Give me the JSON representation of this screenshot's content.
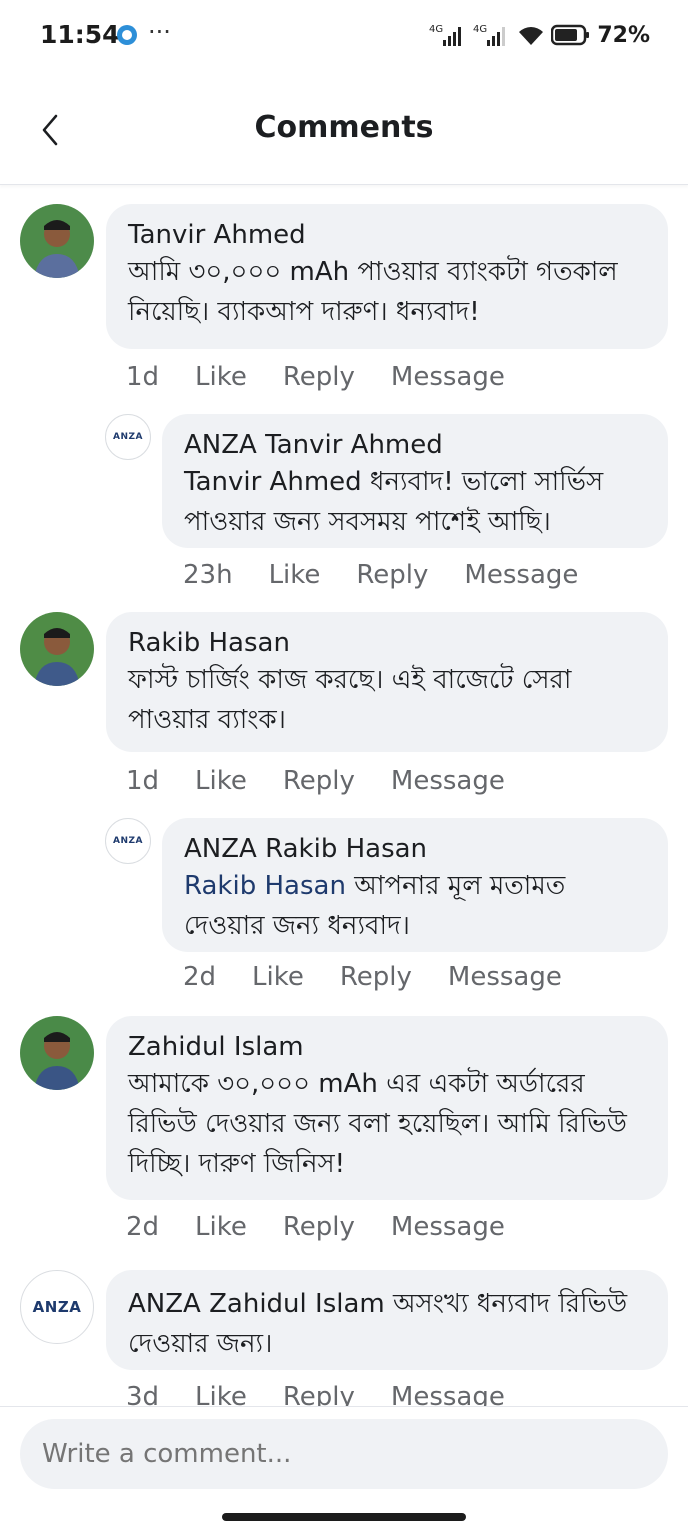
{
  "status_bar": {
    "time": "11:54",
    "dots": "···",
    "battery": "72%",
    "network1": "4G",
    "network2": "4G"
  },
  "header": {
    "title": "Comments",
    "back_icon": "chevron-left-icon"
  },
  "comments": [
    {
      "author": "Tanvir Ahmed",
      "text": "আমি ৩০,০০০ mAh পাওয়ার ব্যাংকটা গতকাল নিয়েছি। ব্যাকআপ দারুণ। ধন্যবাদ!",
      "time": "1d",
      "like": "Like",
      "reply": "Reply",
      "message": "Message"
    },
    {
      "author": "ANZA",
      "mention": "Tanvir Ahmed",
      "text": "Tanvir Ahmed ধন্যবাদ! ভালো সার্ভিস পাওয়ার জন্য সবসময় পাশেই আছি।",
      "time": "23h",
      "like": "Like",
      "reply": "Reply",
      "message": "Message"
    },
    {
      "author": "Rakib Hasan",
      "text": "ফাস্ট চার্জিং কাজ করছে। এই বাজেটে সেরা পাওয়ার ব্যাংক।",
      "time": "1d",
      "like": "Like",
      "reply": "Reply",
      "message": "Message"
    },
    {
      "author": "ANZA",
      "mention": "Rakib Hasan",
      "text": "আপনার মূল মতামত দেওয়ার জন্য ধন্যবাদ।",
      "time": "2d",
      "like": "Like",
      "reply": "Reply",
      "message": "Message"
    },
    {
      "author": "Zahidul Islam",
      "text": "আমাকে ৩০,০০০ mAh এর একটা অর্ডারের রিভিউ দেওয়ার জন্য বলা হয়েছিল। আমি রিভিউ দিচ্ছি। দারুণ জিনিস!",
      "time": "2d",
      "like": "Like",
      "reply": "Reply",
      "message": "Message"
    },
    {
      "author": "ANZA",
      "mention": "Zahidul Islam",
      "text": "অসংখ্য ধন্যবাদ রিভিউ দেওয়ার জন্য।",
      "time": "3d",
      "like": "Like",
      "reply": "Reply",
      "message": "Message"
    }
  ],
  "brand": {
    "logo_text": "ANZA",
    "logo_color": "#1e3a6d"
  },
  "composer": {
    "placeholder": "Write a comment..."
  },
  "colors": {
    "bubble": "#f0f2f5",
    "meta": "#65676b",
    "mention": "#1e3a6d"
  }
}
